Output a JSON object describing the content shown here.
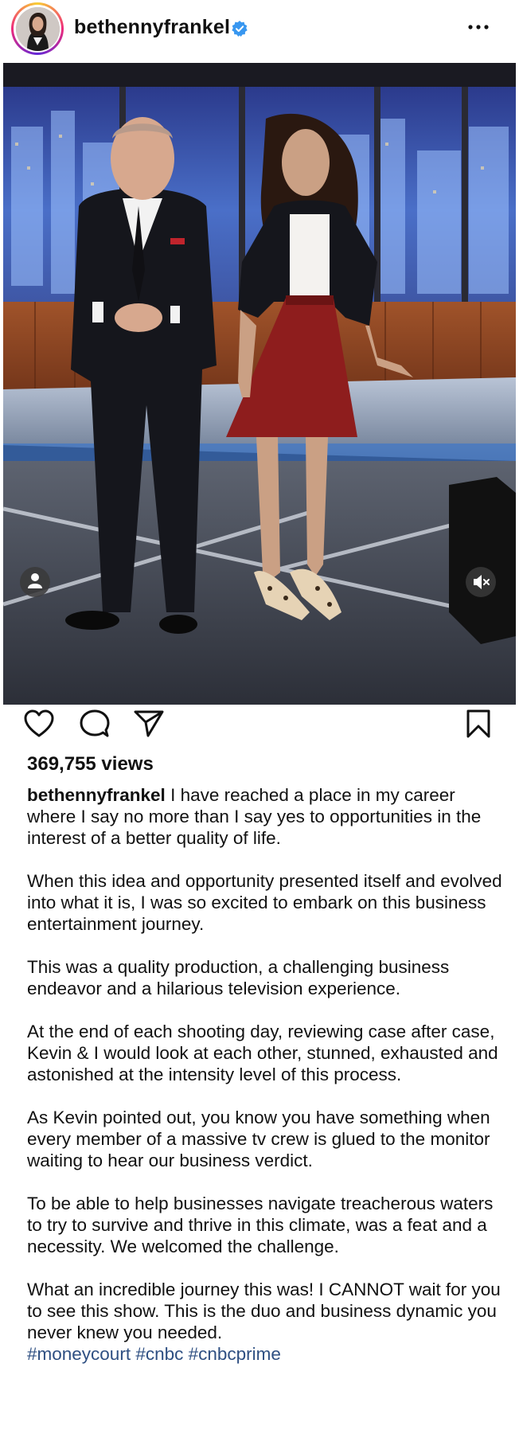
{
  "header": {
    "username": "bethennyfrankel",
    "verified": true,
    "more_icon": "more-horizontal-icon"
  },
  "media": {
    "type": "video",
    "user_tag_icon": "person-icon",
    "mute_icon": "speaker-muted-icon"
  },
  "actions": {
    "like_icon": "heart-icon",
    "comment_icon": "comment-icon",
    "share_icon": "paper-plane-icon",
    "save_icon": "bookmark-icon"
  },
  "views": "369,755 views",
  "caption": {
    "username": "bethennyfrankel",
    "first_paragraph": "I have reached a place in my career where I say no more than I say yes to opportunities in the interest of a better quality of life.",
    "paragraphs": [
      "When this idea and opportunity presented itself and evolved into what it is, I was so excited to embark on this business entertainment journey.",
      "This was a quality production, a challenging business endeavor and a hilarious television experience.",
      "At the end of each shooting day, reviewing case after case, Kevin & I would look at each other, stunned, exhausted and astonished at the intensity level of this process.",
      "As Kevin pointed out, you know you have something when every member of a massive tv crew is glued to the monitor waiting to hear our business verdict.",
      "To be able to help businesses navigate treacherous waters to try to survive and thrive in this climate, was a feat and a necessity. We welcomed the challenge.",
      "What an incredible journey this was! I CANNOT wait for you to see this show. This is the duo and business dynamic you never knew you needed."
    ],
    "hashtags": "#moneycourt #cnbc #cnbcprime"
  },
  "colors": {
    "hashtag": "#2e4f82",
    "verified": "#3897f0",
    "skirt": "#8e1d1d"
  }
}
